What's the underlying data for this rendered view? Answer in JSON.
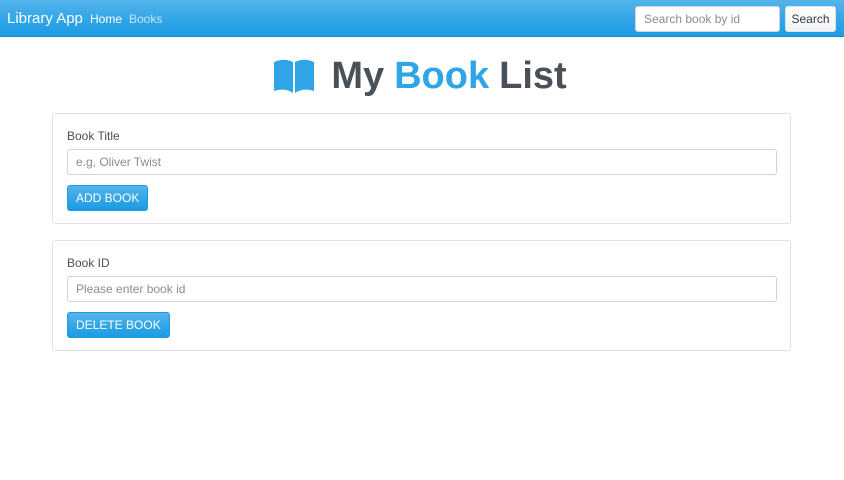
{
  "navbar": {
    "brand": "Library App",
    "links": [
      {
        "label": "Home"
      },
      {
        "label": "Books"
      }
    ],
    "search": {
      "placeholder": "Search book by id",
      "value": "",
      "button_label": "Search"
    }
  },
  "title": {
    "icon": "book-open-icon",
    "word1": "My",
    "word2": "Book",
    "word3": "List",
    "accent_color": "#2fa4e7"
  },
  "add_form": {
    "label": "Book Title",
    "placeholder": "e.g, Oliver Twist",
    "value": "",
    "button_label": "ADD BOOK"
  },
  "delete_form": {
    "label": "Book ID",
    "placeholder": "Please enter book id",
    "value": "",
    "button_label": "DELETE BOOK"
  },
  "colors": {
    "primary": "#2fa4e7",
    "text": "#495057",
    "border": "#dfe3e6"
  }
}
